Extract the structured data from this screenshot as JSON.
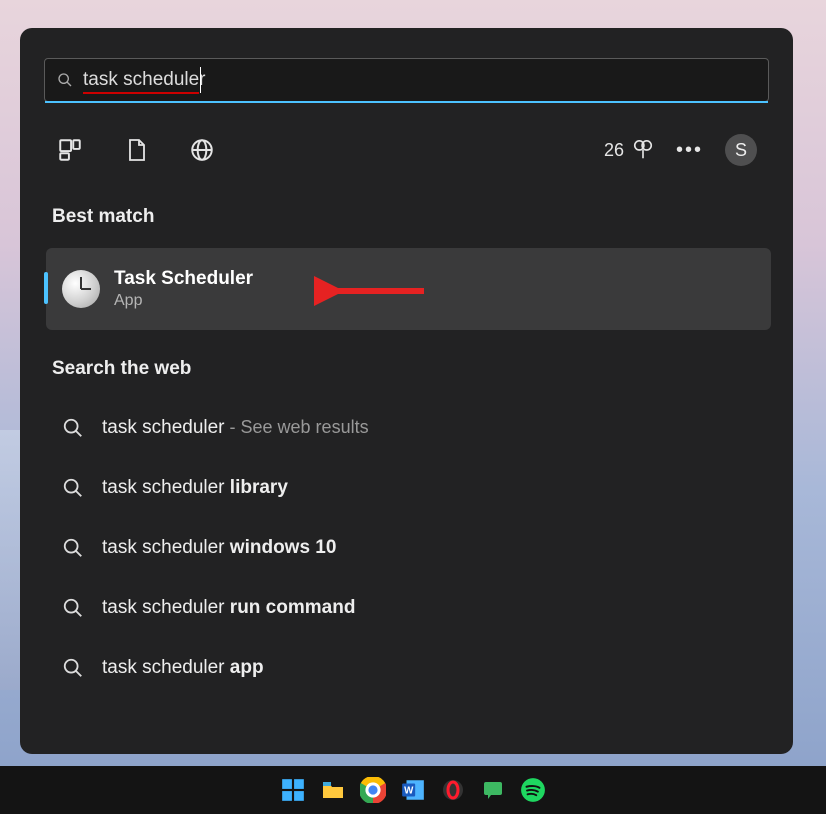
{
  "search": {
    "value": "task scheduler"
  },
  "toolbar": {
    "rewards_count": "26",
    "avatar_initial": "S"
  },
  "sections": {
    "best_match_header": "Best match",
    "web_header": "Search the web"
  },
  "best_match": {
    "title": "Task Scheduler",
    "subtitle": "App"
  },
  "web_results": [
    {
      "prefix": "task scheduler",
      "bold": "",
      "suffix": " - See web results"
    },
    {
      "prefix": "task scheduler ",
      "bold": "library",
      "suffix": ""
    },
    {
      "prefix": "task scheduler ",
      "bold": "windows 10",
      "suffix": ""
    },
    {
      "prefix": "task scheduler ",
      "bold": "run command",
      "suffix": ""
    },
    {
      "prefix": "task scheduler ",
      "bold": "app",
      "suffix": ""
    }
  ]
}
